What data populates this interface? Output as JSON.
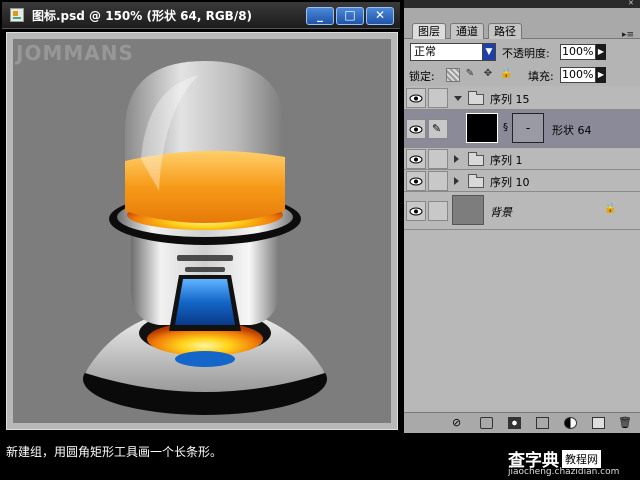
{
  "document": {
    "title": "图标.psd @ 150% (形状 64, RGB/8)",
    "buttons": {
      "minimize": "_",
      "maximize": "□",
      "close": "✕"
    },
    "canvas_watermark": "JOMMANS"
  },
  "layers_panel": {
    "tabs": [
      {
        "label": "图层",
        "active": true
      },
      {
        "label": "通道",
        "active": false
      },
      {
        "label": "路径",
        "active": false
      }
    ],
    "blend_mode": "正常",
    "opacity_label": "不透明度:",
    "opacity_value": "100%",
    "lock_label": "锁定:",
    "fill_label": "填充:",
    "fill_value": "100%",
    "layers": [
      {
        "name": "序列 15",
        "type": "group",
        "expanded": true,
        "visible": true,
        "selected": false
      },
      {
        "name": "形状 64",
        "type": "shape",
        "visible": true,
        "selected": true,
        "mask_label": "-"
      },
      {
        "name": "序列 1",
        "type": "group",
        "expanded": false,
        "visible": true,
        "selected": false
      },
      {
        "name": "序列 10",
        "type": "group",
        "expanded": false,
        "visible": true,
        "selected": false
      },
      {
        "name": "背景",
        "type": "background",
        "visible": true,
        "selected": false,
        "locked": true
      }
    ]
  },
  "caption": "新建组，用圆角矩形工具画一个长条形。",
  "site": {
    "logo": "查字典",
    "logo_box": "教程网",
    "url": "jiaocheng.chazidian.com"
  },
  "colors": {
    "accent_blue": "#1e54a8",
    "selected_layer": "#8a8a98",
    "canvas_bg": "#7d7d7d"
  }
}
